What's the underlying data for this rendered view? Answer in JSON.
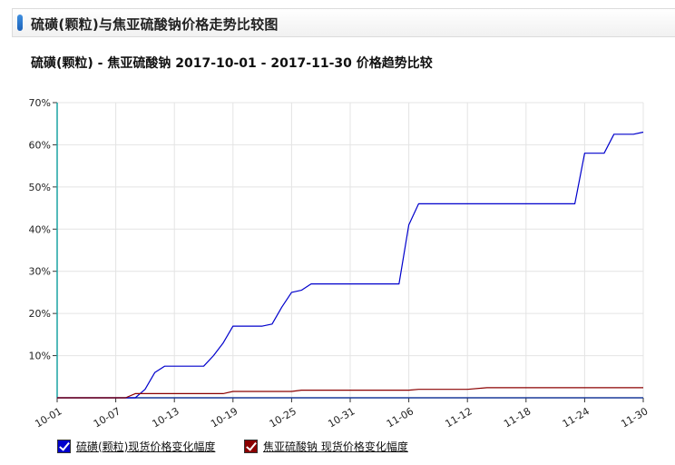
{
  "panel": {
    "title": "硫磺(颗粒)与焦亚硫酸钠价格走势比较图"
  },
  "chart_data": {
    "type": "line",
    "title": "硫磺(颗粒) - 焦亚硫酸钠 2017-10-01 - 2017-11-30 价格趋势比较",
    "xlabel": "",
    "ylabel": "",
    "x_ticks": [
      "10-01",
      "10-07",
      "10-13",
      "10-19",
      "10-25",
      "10-31",
      "11-06",
      "11-12",
      "11-18",
      "11-24",
      "11-30"
    ],
    "y_ticks": [
      "10%",
      "20%",
      "30%",
      "40%",
      "50%",
      "60%",
      "70%"
    ],
    "xlim": [
      "2017-10-01",
      "2017-11-30"
    ],
    "ylim": [
      0,
      70
    ],
    "y_unit": "%",
    "grid": true,
    "legend_position": "bottom-left",
    "series": [
      {
        "name": "硫磺(颗粒)现货价格变化幅度",
        "color": "#0000cc",
        "points": [
          [
            "2017-10-01",
            0
          ],
          [
            "2017-10-08",
            0
          ],
          [
            "2017-10-09",
            0
          ],
          [
            "2017-10-10",
            2
          ],
          [
            "2017-10-11",
            6
          ],
          [
            "2017-10-12",
            7.5
          ],
          [
            "2017-10-13",
            7.5
          ],
          [
            "2017-10-14",
            7.5
          ],
          [
            "2017-10-15",
            7.5
          ],
          [
            "2017-10-16",
            7.5
          ],
          [
            "2017-10-17",
            10
          ],
          [
            "2017-10-18",
            13
          ],
          [
            "2017-10-19",
            17
          ],
          [
            "2017-10-20",
            17
          ],
          [
            "2017-10-21",
            17
          ],
          [
            "2017-10-22",
            17
          ],
          [
            "2017-10-23",
            17.5
          ],
          [
            "2017-10-24",
            21.5
          ],
          [
            "2017-10-25",
            25
          ],
          [
            "2017-10-26",
            25.5
          ],
          [
            "2017-10-27",
            27
          ],
          [
            "2017-11-05",
            27
          ],
          [
            "2017-11-06",
            41
          ],
          [
            "2017-11-07",
            46
          ],
          [
            "2017-11-23",
            46
          ],
          [
            "2017-11-24",
            58
          ],
          [
            "2017-11-26",
            58
          ],
          [
            "2017-11-27",
            62.5
          ],
          [
            "2017-11-29",
            62.5
          ],
          [
            "2017-11-30",
            63
          ]
        ]
      },
      {
        "name": "焦亚硫酸钠 现货价格变化幅度",
        "color": "#8b0000",
        "points": [
          [
            "2017-10-01",
            0
          ],
          [
            "2017-10-08",
            0
          ],
          [
            "2017-10-09",
            1
          ],
          [
            "2017-10-18",
            1
          ],
          [
            "2017-10-19",
            1.5
          ],
          [
            "2017-10-25",
            1.5
          ],
          [
            "2017-10-26",
            1.8
          ],
          [
            "2017-11-06",
            1.8
          ],
          [
            "2017-11-07",
            2
          ],
          [
            "2017-11-12",
            2
          ],
          [
            "2017-11-14",
            2.4
          ],
          [
            "2017-11-30",
            2.4
          ]
        ]
      }
    ]
  }
}
